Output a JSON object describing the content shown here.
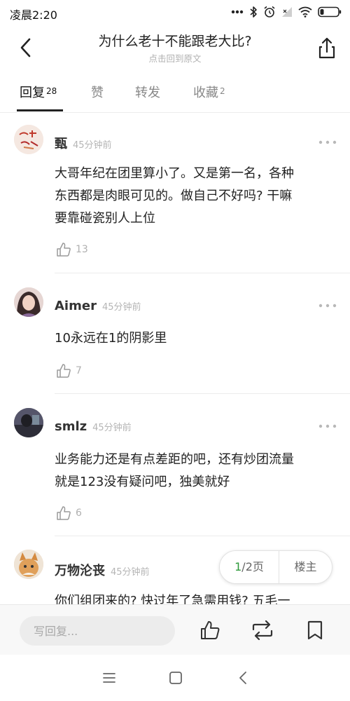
{
  "status_bar": {
    "time": "凌晨2:20",
    "icons": [
      "more-dots-icon",
      "bluetooth-icon",
      "alarm-icon",
      "signal-icon",
      "wifi-icon",
      "battery-icon"
    ]
  },
  "header": {
    "title": "为什么老十不能跟老大比?",
    "subtitle": "点击回到原文"
  },
  "tabs": [
    {
      "label": "回复",
      "count": "28",
      "active": true
    },
    {
      "label": "赞",
      "count": "",
      "active": false
    },
    {
      "label": "转发",
      "count": "",
      "active": false
    },
    {
      "label": "收藏",
      "count": "2",
      "active": false
    }
  ],
  "comments": [
    {
      "username": "甄",
      "time": "45分钟前",
      "lines": [
        "大哥年纪在团里算小了。又是第一名，各种",
        "东西都是肉眼可见的。做自己不好吗? 干嘛",
        "要靠碰瓷别人上位"
      ],
      "likes": "13"
    },
    {
      "username": "Aimer",
      "time": "45分钟前",
      "lines": [
        "10永远在1的阴影里"
      ],
      "likes": "7"
    },
    {
      "username": "smlz",
      "time": "45分钟前",
      "lines": [
        "业务能力还是有点差距的吧，还有炒团流量",
        "就是123没有疑问吧，独美就好"
      ],
      "likes": "6"
    },
    {
      "username": "万物沦丧",
      "time": "45分钟前",
      "lines": [
        "你们组团来的? 快过年了急需用钱? 五毛一"
      ],
      "likes": ""
    }
  ],
  "pager": {
    "current": "1",
    "separator": "/2页",
    "owner_label": "楼主"
  },
  "bottom_bar": {
    "reply_placeholder": "写回复..."
  },
  "colors": {
    "accent_green": "#2e9a3a",
    "text_primary": "#222222",
    "text_muted": "#b0b0b0",
    "divider": "#ececec"
  }
}
